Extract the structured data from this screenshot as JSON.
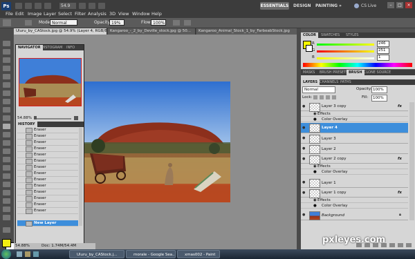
{
  "app": {
    "logo": "Ps",
    "zoom_box": "54.9"
  },
  "menu": [
    "File",
    "Edit",
    "Image",
    "Layer",
    "Select",
    "Filter",
    "Analysis",
    "3D",
    "View",
    "Window",
    "Help"
  ],
  "workspaces": {
    "active": "ESSENTIALS",
    "design": "DESIGN",
    "painting": "PAINTING",
    "more": "»",
    "cs_live": "CS Live"
  },
  "window_buttons": [
    "–",
    "□",
    "×"
  ],
  "options": {
    "mode_label": "Mode:",
    "mode_value": "Normal",
    "opacity_label": "Opacity:",
    "opacity_value": "19%",
    "flow_label": "Flow:",
    "flow_value": "100%"
  },
  "doc_tabs": [
    "Uluru_by_CAStock.jpg @ 54.9% (Layer 4, RGB/8#) *",
    "Kangaroo_-_2_by_Deville_stock.jpg @ 50...",
    "Kangaroo_Animal_Stock_1_by_FarbeabStock.jpg"
  ],
  "navigator": {
    "tabs": [
      "NAVIGATOR",
      "HISTOGRAM",
      "INFO"
    ],
    "zoom": "54.88%"
  },
  "history": {
    "tab": "HISTORY",
    "items": [
      "Eraser",
      "Eraser",
      "Eraser",
      "Eraser",
      "Eraser",
      "Eraser",
      "Eraser",
      "Eraser",
      "Eraser",
      "Eraser",
      "Eraser",
      "Eraser",
      "Eraser",
      "Eraser",
      "New Layer"
    ]
  },
  "status": {
    "zoom": "54.88%",
    "doc": "Doc: 1.74M/54.4M"
  },
  "color_panel": {
    "tabs": [
      "COLOR",
      "SWATCHES",
      "STYLES"
    ],
    "r_label": "R",
    "r_value": "246",
    "g_label": "G",
    "g_value": "251",
    "b_label": "B",
    "b_value": "1",
    "foreground_hex": "#f6fb01"
  },
  "masks_tabs": [
    "MASKS",
    "BRUSH PRESETS",
    "BRUSH",
    "CLONE SOURCE"
  ],
  "layers_panel": {
    "tabs": [
      "LAYERS",
      "CHANNELS",
      "PATHS"
    ],
    "blend_mode": "Normal",
    "opacity_label": "Opacity:",
    "opacity_value": "100%",
    "lock_label": "Lock:",
    "fill_label": "Fill:",
    "fill_value": "100%",
    "effects_label": "Effects",
    "color_overlay_label": "Color Overlay",
    "fx_label": "fx",
    "layers": [
      {
        "name": "Layer 3 copy",
        "fx": true,
        "selected": false
      },
      {
        "name": "Layer 4",
        "fx": false,
        "selected": true
      },
      {
        "name": "Layer 3",
        "fx": false,
        "selected": false
      },
      {
        "name": "Layer 2",
        "fx": false,
        "selected": false
      },
      {
        "name": "Layer 2 copy",
        "fx": true,
        "selected": false
      },
      {
        "name": "Layer 1",
        "fx": false,
        "selected": false
      },
      {
        "name": "Layer 1 copy",
        "fx": true,
        "selected": false
      },
      {
        "name": "Background",
        "fx": false,
        "selected": false
      }
    ]
  },
  "taskbar": {
    "items": [
      "Uluru_by_CAStock.j...",
      "morale - Google Sea...",
      "xmas002 - Paint"
    ]
  },
  "watermark": "pxleyes.com",
  "colors": {
    "accent": "#3d8edb",
    "panel_dark": "#3c3c3c",
    "panel_light": "#d6d6d6"
  }
}
